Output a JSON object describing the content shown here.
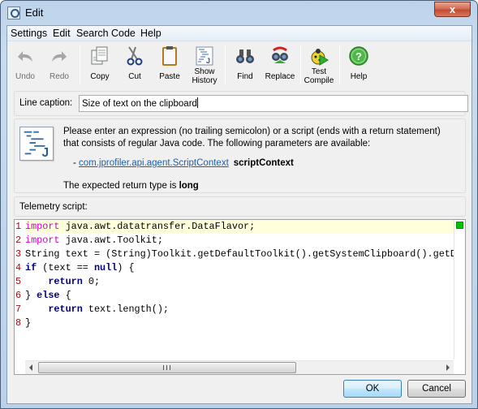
{
  "window": {
    "title": "Edit",
    "close_label": "x"
  },
  "menu": [
    "Settings",
    "Edit",
    "Search",
    "Code",
    "Help"
  ],
  "toolbar": {
    "undo": "Undo",
    "redo": "Redo",
    "copy": "Copy",
    "cut": "Cut",
    "paste": "Paste",
    "show_history_1": "Show",
    "show_history_2": "History",
    "find": "Find",
    "replace": "Replace",
    "test_compile_1": "Test",
    "test_compile_2": "Compile",
    "help": "Help"
  },
  "caption": {
    "label": "Line caption:",
    "value": "Size of text on the clipboard"
  },
  "info": {
    "description": "Please enter an expression (no trailing semicolon) or a script (ends with a return statement) that consists of regular Java code. The following parameters are available:",
    "param_prefix": "- ",
    "param_type": "com.jprofiler.api.agent.ScriptContext",
    "param_name": "scriptContext",
    "return_prefix": "The expected return type is ",
    "return_type": "long"
  },
  "script": {
    "label": "Telemetry script:",
    "lines": [
      {
        "n": "1",
        "kw": "import",
        "text": " java.awt.datatransfer.DataFlavor;"
      },
      {
        "n": "2",
        "kw": "import",
        "text": " java.awt.Toolkit;"
      },
      {
        "n": "3",
        "kw": "",
        "text": "String text = (String)Toolkit.getDefaultToolkit().getSystemClipboard().getData(DataFlavor.stringFlavor);"
      },
      {
        "n": "4",
        "kw": "",
        "text": "if (text == null) {"
      },
      {
        "n": "5",
        "kw": "",
        "text": "    return 0;"
      },
      {
        "n": "6",
        "kw": "",
        "text": "} else {"
      },
      {
        "n": "7",
        "kw": "",
        "text": "    return text.length();"
      },
      {
        "n": "8",
        "kw": "",
        "text": "}"
      }
    ]
  },
  "buttons": {
    "ok": "OK",
    "cancel": "Cancel"
  },
  "colors": {
    "keyword_import": "#d000c8",
    "line_number": "#a01010",
    "current_line": "#ffffdc",
    "status_ok": "#00c000",
    "link": "#1d5fa8"
  }
}
